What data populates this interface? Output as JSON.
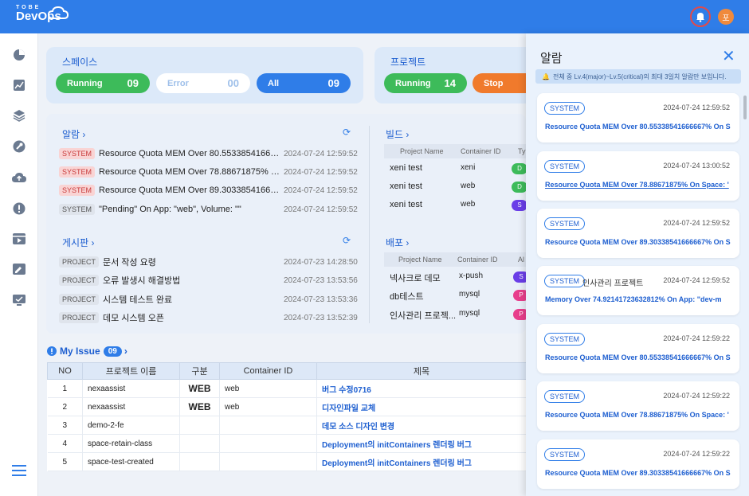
{
  "brand": {
    "top": "TOBE",
    "name": "DevOps"
  },
  "header": {
    "avatar_initial": "포"
  },
  "space": {
    "title": "스페이스",
    "running_label": "Running",
    "running_count": "09",
    "error_label": "Error",
    "error_count": "00",
    "all_label": "All",
    "all_count": "09"
  },
  "project": {
    "title": "프로젝트",
    "running_label": "Running",
    "running_count": "14",
    "stop_label": "Stop"
  },
  "alarms_section": {
    "title": "알람 ›",
    "rows": [
      {
        "tag": "SYSTEM",
        "text": "Resource Quota MEM Over 80.5533854166666...",
        "time": "2024-07-24 12:59:52"
      },
      {
        "tag": "SYSTEM",
        "text": "Resource Quota MEM Over 78.88671875% On ...",
        "time": "2024-07-24 12:59:52"
      },
      {
        "tag": "SYSTEM",
        "text": "Resource Quota MEM Over 89.3033854166666...",
        "time": "2024-07-24 12:59:52"
      },
      {
        "tag": "SYSTEM",
        "text": "\"Pending\" On App: \"web\", Volume: \"\"",
        "time": "2024-07-24 12:59:52"
      }
    ]
  },
  "board": {
    "title": "게시판 ›",
    "rows": [
      {
        "tag": "PROJECT",
        "text": "문서 작성 요령",
        "time": "2024-07-23 14:28:50"
      },
      {
        "tag": "PROJECT",
        "text": "오류 발생시 해결방법",
        "time": "2024-07-23 13:53:56"
      },
      {
        "tag": "PROJECT",
        "text": "시스템 테스트 완료",
        "time": "2024-07-23 13:53:36"
      },
      {
        "tag": "PROJECT",
        "text": "데모 시스템 오픈",
        "time": "2024-07-23 13:52:39"
      }
    ]
  },
  "build": {
    "title": "빌드 ›",
    "headers": [
      "Project Name",
      "Container ID",
      "Ty"
    ],
    "rows": [
      {
        "name": "xeni test",
        "container": "xeni",
        "badge": "D"
      },
      {
        "name": "xeni test",
        "container": "web",
        "badge": "D"
      },
      {
        "name": "xeni test",
        "container": "web",
        "badge": "S"
      }
    ]
  },
  "deploy": {
    "title": "배포 ›",
    "headers": [
      "Project Name",
      "Container ID",
      "Al"
    ],
    "rows": [
      {
        "name": "넥사크로 데모",
        "container": "x-push",
        "badge": "S"
      },
      {
        "name": "db테스트",
        "container": "mysql",
        "badge": "P"
      },
      {
        "name": "인사관리 프로젝...",
        "container": "mysql",
        "badge": "P"
      }
    ]
  },
  "my_issue": {
    "title": "My Issue",
    "count": "09",
    "headers": [
      "NO",
      "프로젝트 이름",
      "구분",
      "Container ID",
      "제목"
    ],
    "rows": [
      {
        "no": "1",
        "project": "nexaassist",
        "type": "WEB",
        "container": "web",
        "title": "버그 수정0716"
      },
      {
        "no": "2",
        "project": "nexaassist",
        "type": "WEB",
        "container": "web",
        "title": "디자인파일 교체"
      },
      {
        "no": "3",
        "project": "demo-2-fe",
        "type": "",
        "container": "",
        "title": "데모 소스 디자인 변경"
      },
      {
        "no": "4",
        "project": "space-retain-class",
        "type": "",
        "container": "",
        "title": "Deployment의 initContainers 렌더링 버그"
      },
      {
        "no": "5",
        "project": "space-test-created",
        "type": "",
        "container": "",
        "title": "Deployment의 initContainers 렌더링 버그"
      }
    ]
  },
  "alarm_panel": {
    "title": "알람",
    "notice": "전체 중 Lv.4(major)~Lv.5(critical)의 최대 3일치 알람만 보입니다.",
    "items": [
      {
        "tag": "SYSTEM",
        "project": "",
        "time": "2024-07-24 12:59:52",
        "message": "Resource Quota MEM Over 80.55338541666667% On S"
      },
      {
        "tag": "SYSTEM",
        "project": "",
        "time": "2024-07-24 13:00:52",
        "message": "Resource Quota MEM Over 78.88671875% On Space: '"
      },
      {
        "tag": "SYSTEM",
        "project": "",
        "time": "2024-07-24 12:59:52",
        "message": "Resource Quota MEM Over 89.30338541666667% On S"
      },
      {
        "tag": "SYSTEM",
        "project": "인사관리 프로젝트",
        "time": "2024-07-24 12:59:52",
        "message": "Memory Over 74.92141723632812%  On App: \"dev-m"
      },
      {
        "tag": "SYSTEM",
        "project": "",
        "time": "2024-07-24 12:59:22",
        "message": "Resource Quota MEM Over 80.55338541666667% On S"
      },
      {
        "tag": "SYSTEM",
        "project": "",
        "time": "2024-07-24 12:59:22",
        "message": "Resource Quota MEM Over 78.88671875% On Space: '"
      },
      {
        "tag": "SYSTEM",
        "project": "",
        "time": "2024-07-24 12:59:22",
        "message": "Resource Quota MEM Over 89.30338541666667% On S"
      }
    ]
  },
  "colors": {
    "primary": "#2f7de8",
    "running": "#3dbb5a",
    "stop": "#f07a2c",
    "badge_green": "#3dbb5a",
    "badge_purple": "#6a3ee8",
    "badge_pink": "#e83e8c"
  }
}
